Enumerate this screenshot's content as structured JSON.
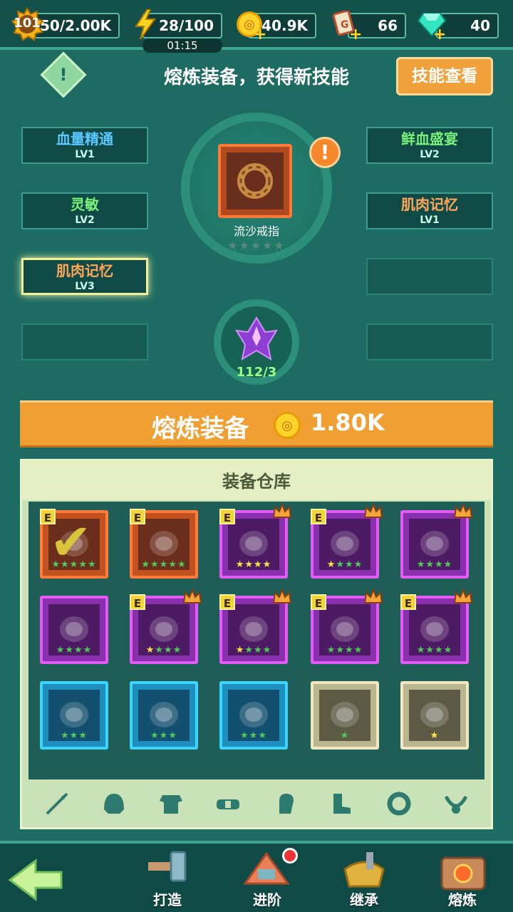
{
  "topbar": {
    "level": "101",
    "exp": "50/2.00K",
    "energy": "28/100",
    "energy_timer": "01:15",
    "coins": "140.9K",
    "tickets": "66",
    "gems": "40"
  },
  "header": {
    "title": "熔炼装备，获得新技能",
    "skill_button": "技能查看"
  },
  "skills_left": [
    {
      "name": "血量精通",
      "level": "LV1"
    },
    {
      "name": "灵敏",
      "level": "LV2"
    },
    {
      "name": "肌肉记忆",
      "level": "LV3"
    }
  ],
  "skills_right": [
    {
      "name": "鲜血盛宴",
      "level": "LV2"
    },
    {
      "name": "肌肉记忆",
      "level": "LV1"
    }
  ],
  "center": {
    "item_name": "流沙戒指",
    "alert": "!",
    "material_count": "112/3",
    "stars": "★★★★★"
  },
  "smelt": {
    "label": "熔炼装备",
    "cost": "1.80K"
  },
  "warehouse": {
    "title": "装备仓库",
    "items": [
      {
        "frame": "orange",
        "stars": "★★★★★",
        "gold": 0,
        "badge": "E",
        "crown": false,
        "checked": true
      },
      {
        "frame": "orange",
        "stars": "★★★★★",
        "gold": 0,
        "badge": "E",
        "crown": false,
        "checked": false
      },
      {
        "frame": "purple",
        "stars": "★★★★",
        "gold": 4,
        "badge": "E",
        "crown": true,
        "checked": false
      },
      {
        "frame": "purple",
        "stars": "★★★★",
        "gold": 1,
        "badge": "E",
        "crown": true,
        "checked": false
      },
      {
        "frame": "purple",
        "stars": "★★★★",
        "gold": 0,
        "badge": "",
        "crown": true,
        "checked": false
      },
      {
        "frame": "purple",
        "stars": "★★★★",
        "gold": 0,
        "badge": "",
        "crown": false,
        "checked": false
      },
      {
        "frame": "purple",
        "stars": "★★★★",
        "gold": 1,
        "badge": "E",
        "crown": true,
        "checked": false
      },
      {
        "frame": "purple",
        "stars": "★★★★",
        "gold": 1,
        "badge": "E",
        "crown": true,
        "checked": false
      },
      {
        "frame": "purple",
        "stars": "★★★★",
        "gold": 0,
        "badge": "E",
        "crown": true,
        "checked": false
      },
      {
        "frame": "purple",
        "stars": "★★★★",
        "gold": 0,
        "badge": "E",
        "crown": true,
        "checked": false
      },
      {
        "frame": "blue",
        "stars": "★★★",
        "gold": 0,
        "badge": "",
        "crown": false,
        "checked": false
      },
      {
        "frame": "blue",
        "stars": "★★★",
        "gold": 0,
        "badge": "",
        "crown": false,
        "checked": false
      },
      {
        "frame": "blue",
        "stars": "★★★",
        "gold": 0,
        "badge": "",
        "crown": false,
        "checked": false
      },
      {
        "frame": "white",
        "stars": "★",
        "gold": 0,
        "badge": "",
        "crown": false,
        "checked": false
      },
      {
        "frame": "white",
        "stars": "★",
        "gold": 1,
        "badge": "",
        "crown": false,
        "checked": false
      }
    ],
    "filters": [
      "weapon-icon",
      "helmet-icon",
      "armor-icon",
      "belt-icon",
      "glove-icon",
      "boots-icon",
      "ring-icon",
      "necklace-icon"
    ]
  },
  "bottom_nav": [
    {
      "label": "打造",
      "icon": "hammer-icon"
    },
    {
      "label": "进阶",
      "icon": "upgrade-icon"
    },
    {
      "label": "继承",
      "icon": "inherit-icon"
    },
    {
      "label": "熔炼",
      "icon": "smelt-icon"
    }
  ],
  "colors": {
    "accent_orange": "#f0a032",
    "panel_teal": "#1d6b62",
    "warehouse_bg": "#c9e2b7"
  }
}
